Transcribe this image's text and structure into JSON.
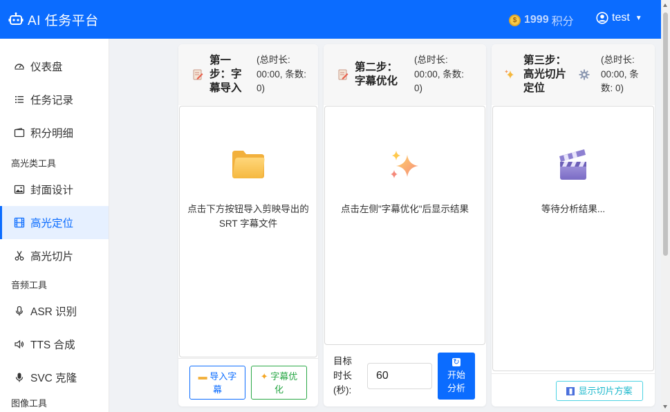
{
  "header": {
    "app_title": "AI 任务平台",
    "points_value": "1999",
    "points_unit": "积分",
    "username": "test",
    "brand_color": "#0b6cff"
  },
  "sidebar": {
    "items_top": [
      {
        "label": "仪表盘",
        "icon": "dashboard-icon"
      },
      {
        "label": "任务记录",
        "icon": "list-icon"
      },
      {
        "label": "积分明细",
        "icon": "wallet-icon"
      }
    ],
    "group_highlight": "高光类工具",
    "items_highlight": [
      {
        "label": "封面设计",
        "icon": "image-icon"
      },
      {
        "label": "高光定位",
        "icon": "film-icon",
        "active": true
      },
      {
        "label": "高光切片",
        "icon": "scissors-icon"
      }
    ],
    "group_audio": "音频工具",
    "items_audio": [
      {
        "label": "ASR 识别",
        "icon": "mic-icon"
      },
      {
        "label": "TTS 合成",
        "icon": "speaker-icon"
      },
      {
        "label": "SVC 克隆",
        "icon": "mic-icon"
      }
    ],
    "group_image": "图像工具"
  },
  "step1": {
    "title": "第一步：字幕导入",
    "meta": "(总时长: 00:00, 条数: 0)",
    "empty_text": "点击下方按钮导入剪映导出的 SRT 字幕文件",
    "btn_import": "导入字幕",
    "btn_optimize": "字幕优化"
  },
  "step2": {
    "title": "第二步：字幕优化",
    "meta": "(总时长: 00:00, 条数: 0)",
    "empty_text": "点击左侧\"字幕优化\"后显示结果",
    "duration_label": "目标时长(秒):",
    "duration_value": "60",
    "btn_analyze": "开始分析"
  },
  "step3": {
    "title": "第三步：高光切片定位",
    "meta": "(总时长: 00:00, 条数: 0)",
    "empty_text": "等待分析结果...",
    "btn_show": "显示切片方案"
  }
}
